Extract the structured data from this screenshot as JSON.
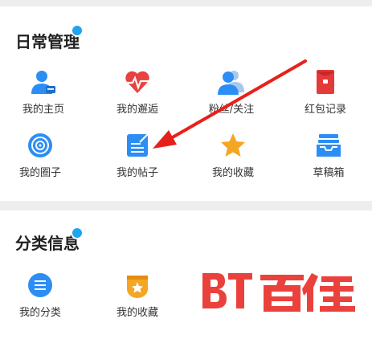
{
  "sections": [
    {
      "title": "日常管理",
      "items": [
        {
          "label": "我的主页",
          "icon": "user-card-icon"
        },
        {
          "label": "我的邂逅",
          "icon": "heart-pulse-icon"
        },
        {
          "label": "粉丝/关注",
          "icon": "users-icon"
        },
        {
          "label": "红包记录",
          "icon": "red-envelope-icon"
        },
        {
          "label": "我的圈子",
          "icon": "circle-target-icon"
        },
        {
          "label": "我的帖子",
          "icon": "post-edit-icon"
        },
        {
          "label": "我的收藏",
          "icon": "star-icon"
        },
        {
          "label": "草稿箱",
          "icon": "inbox-tray-icon"
        }
      ]
    },
    {
      "title": "分类信息",
      "items": [
        {
          "label": "我的分类",
          "icon": "list-icon"
        },
        {
          "label": "我的收藏",
          "icon": "star-badge-icon"
        }
      ]
    }
  ],
  "colors": {
    "accent_blue": "#2c8ef4",
    "heart_red": "#e94040",
    "envelope_red": "#e43a3a",
    "star_orange": "#f5a623",
    "arrow_red": "#e8201a"
  }
}
